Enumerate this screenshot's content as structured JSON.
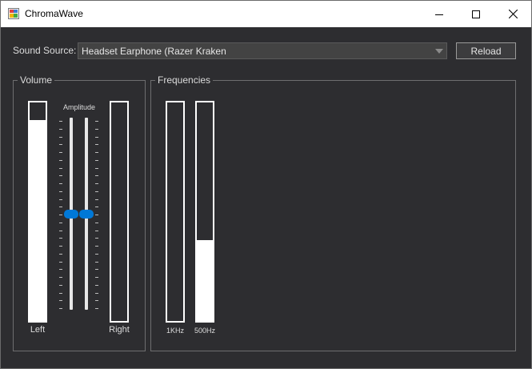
{
  "window": {
    "title": "ChromaWave",
    "controls": {
      "minimize_icon": "minimize-icon",
      "maximize_icon": "maximize-icon",
      "close_icon": "close-icon"
    }
  },
  "source": {
    "label": "Sound Source:",
    "selected": "Headset Earphone (Razer Kraken",
    "reload_label": "Reload"
  },
  "volume": {
    "title": "Volume",
    "amplitude_label": "Amplitude",
    "left_label": "Left",
    "right_label": "Right",
    "left_level": 0.92,
    "right_level": 0.0,
    "amplitude_left": 0.5,
    "amplitude_right": 0.5,
    "tick_count": 25
  },
  "frequencies": {
    "title": "Frequencies",
    "bands": [
      {
        "label": "1KHz",
        "level": 0.0
      },
      {
        "label": "500Hz",
        "level": 0.37
      }
    ]
  },
  "colors": {
    "accent": "#0078d7",
    "background": "#2d2d30",
    "meter": "#ffffff"
  }
}
